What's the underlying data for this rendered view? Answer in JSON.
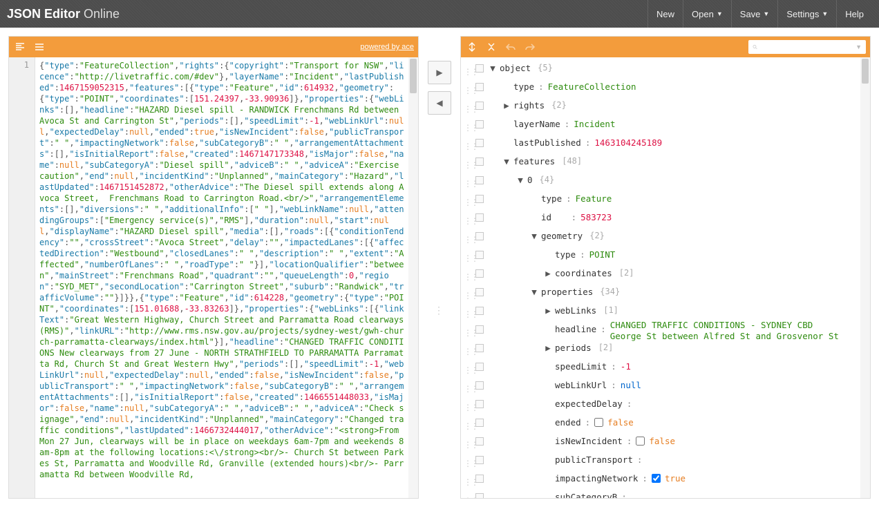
{
  "header": {
    "title_bold": "JSON Editor",
    "title_light": " Online",
    "menu": {
      "new": "New",
      "open": "Open",
      "save": "Save",
      "settings": "Settings",
      "help": "Help"
    }
  },
  "left_toolbar": {
    "powered": "powered by ace"
  },
  "mid": {
    "right_arrow": "▶",
    "left_arrow": "◀"
  },
  "gutter_line": "1",
  "search_placeholder": "",
  "tree": {
    "root_label": "object",
    "root_count": "{5}",
    "type_key": "type",
    "type_val": "FeatureCollection",
    "rights_key": "rights",
    "rights_count": "{2}",
    "layerName_key": "layerName",
    "layerName_val": "Incident",
    "lastPublished_key": "lastPublished",
    "lastPublished_val": "1463104245189",
    "features_key": "features",
    "features_count": "[48]",
    "idx0": "0",
    "idx0_count": "{4}",
    "f_type_key": "type",
    "f_type_val": "Feature",
    "f_id_key": "id",
    "f_id_val": "583723",
    "geometry_key": "geometry",
    "geometry_count": "{2}",
    "g_type_key": "type",
    "g_type_val": "POINT",
    "coords_key": "coordinates",
    "coords_count": "[2]",
    "props_key": "properties",
    "props_count": "{34}",
    "weblinks_key": "webLinks",
    "weblinks_count": "[1]",
    "headline_key": "headline",
    "headline_val": "CHANGED TRAFFIC CONDITIONS - SYDNEY CBD George St between Alfred St and Grosvenor St",
    "periods_key": "periods",
    "periods_count": "[2]",
    "speedLimit_key": "speedLimit",
    "speedLimit_val": "-1",
    "webLinkUrl_key": "webLinkUrl",
    "webLinkUrl_val": "null",
    "expectedDelay_key": "expectedDelay",
    "expectedDelay_val": "",
    "ended_key": "ended",
    "ended_val": "false",
    "isNewIncident_key": "isNewIncident",
    "isNewIncident_val": "false",
    "publicTransport_key": "publicTransport",
    "publicTransport_val": "",
    "impactingNetwork_key": "impactingNetwork",
    "impactingNetwork_val": "true",
    "subCategoryB_key": "subCategoryB",
    "subCategoryB_val": ""
  },
  "code": {
    "raw": "{\"type\":\"FeatureCollection\",\"rights\":{\"copyright\":\"Transport for NSW\",\"licence\":\"http://livetraffic.com/#dev\"},\"layerName\":\"Incident\",\"lastPublished\":1467159052315,\"features\":[{\"type\":\"Feature\",\"id\":614932,\"geometry\":{\"type\":\"POINT\",\"coordinates\":[151.24397,-33.90936]},\"properties\":{\"webLinks\":[],\"headline\":\"HAZARD Diesel spill - RANDWICK Frenchmans Rd between Avoca St and Carrington St\",\"periods\":[],\"speedLimit\":-1,\"webLinkUrl\":null,\"expectedDelay\":null,\"ended\":true,\"isNewIncident\":false,\"publicTransport\":\" \",\"impactingNetwork\":false,\"subCategoryB\":\" \",\"arrangementAttachments\":[],\"isInitialReport\":false,\"created\":1467147173348,\"isMajor\":false,\"name\":null,\"subCategoryA\":\"Diesel spill\",\"adviceB\":\" \",\"adviceA\":\"Exercise caution\",\"end\":null,\"incidentKind\":\"Unplanned\",\"mainCategory\":\"Hazard\",\"lastUpdated\":1467151452872,\"otherAdvice\":\"The Diesel spill extends along Avoca Street,  Frenchmans Road to Carrington Road.<br/>\",\"arrangementElements\":[],\"diversions\":\" \",\"additionalInfo\":[\" \"],\"webLinkName\":null,\"attendingGroups\":[\"Emergency service(s)\",\"RMS\"],\"duration\":null,\"start\":null,\"displayName\":\"HAZARD Diesel spill\",\"media\":[],\"roads\":[{\"conditionTendency\":\"\",\"crossStreet\":\"Avoca Street\",\"delay\":\"\",\"impactedLanes\":[{\"affectedDirection\":\"Westbound\",\"closedLanes\":\" \",\"description\":\" \",\"extent\":\"Affected\",\"numberOfLanes\":\" \",\"roadType\":\" \"}],\"locationQualifier\":\"between\",\"mainStreet\":\"Frenchmans Road\",\"quadrant\":\"\",\"queueLength\":0,\"region\":\"SYD_MET\",\"secondLocation\":\"Carrington Street\",\"suburb\":\"Randwick\",\"trafficVolume\":\"\"}]}},{\"type\":\"Feature\",\"id\":614228,\"geometry\":{\"type\":\"POINT\",\"coordinates\":[151.01688,-33.83263]},\"properties\":{\"webLinks\":[{\"linkText\":\"Great Western Highway, Church Street and Parramatta Road clearways (RMS)\",\"linkURL\":\"http://www.rms.nsw.gov.au/projects/sydney-west/gwh-church-parramatta-clearways/index.html\"}],\"headline\":\"CHANGED TRAFFIC CONDITIONS New clearways from 27 June - NORTH STRATHFIELD TO PARRAMATTA Parramatta Rd, Church St and Great Western Hwy\",\"periods\":[],\"speedLimit\":-1,\"webLinkUrl\":null,\"expectedDelay\":null,\"ended\":false,\"isNewIncident\":false,\"publicTransport\":\" \",\"impactingNetwork\":false,\"subCategoryB\":\" \",\"arrangementAttachments\":[],\"isInitialReport\":false,\"created\":1466551448033,\"isMajor\":false,\"name\":null,\"subCategoryA\":\" \",\"adviceB\":\" \",\"adviceA\":\"Check signage\",\"end\":null,\"incidentKind\":\"Unplanned\",\"mainCategory\":\"Changed traffic conditions\",\"lastUpdated\":1466732444017,\"otherAdvice\":\"<strong>From Mon 27 Jun, clearways will be in place on weekdays 6am-7pm and weekends 8am-8pm at the following locations:<\\/strong><br/>- Church St between Parkes St, Parramatta and Woodville Rd, Granville (extended hours)<br/>- Parramatta Rd between Woodville Rd,"
  }
}
